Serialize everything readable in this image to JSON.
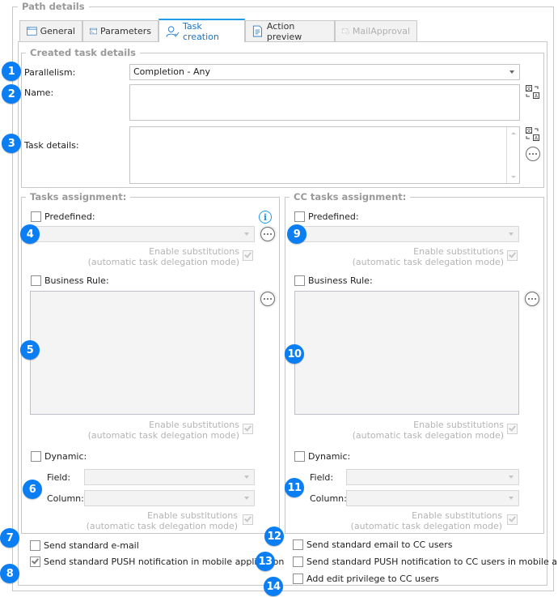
{
  "path_details": {
    "title": "Path details",
    "tabs": [
      {
        "label": "General",
        "icon": "window-icon",
        "state": "normal"
      },
      {
        "label": "Parameters",
        "icon": "console-window-icon",
        "state": "normal"
      },
      {
        "label": "Task creation",
        "icon": "user-task-icon",
        "state": "active"
      },
      {
        "label": "Action preview",
        "icon": "document-preview-icon",
        "state": "normal"
      },
      {
        "label": "MailApproval",
        "icon": "mail-approval-icon",
        "state": "disabled"
      }
    ]
  },
  "created_task_details": {
    "title": "Created task details",
    "parallelism_label": "Parallelism:",
    "parallelism_value": "Completion - Any",
    "name_label": "Name:",
    "name_value": "",
    "task_details_label": "Task details:",
    "task_details_value": "",
    "translate_icon": "translate-icon",
    "more_icon": "ellipsis-circle-icon"
  },
  "tasks_assignment": {
    "title": "Tasks assignment:",
    "predefined_label": "Predefined:",
    "predefined_checked": false,
    "predefined_value": "",
    "info_icon": "info-icon",
    "enable_substitutions_line1": "Enable substitutions",
    "enable_substitutions_line2": "(automatic task delegation mode)",
    "business_rule_label": "Business Rule:",
    "business_rule_checked": false,
    "dynamic_label": "Dynamic:",
    "dynamic_checked": false,
    "field_label": "Field:",
    "field_value": "",
    "column_label": "Column:",
    "column_value": ""
  },
  "cc_tasks_assignment": {
    "title": "CC tasks assignment:",
    "predefined_label": "Predefined:",
    "predefined_checked": false,
    "predefined_value": "",
    "enable_substitutions_line1": "Enable substitutions",
    "enable_substitutions_line2": "(automatic task delegation mode)",
    "business_rule_label": "Business Rule:",
    "business_rule_checked": false,
    "dynamic_label": "Dynamic:",
    "dynamic_checked": false,
    "field_label": "Field:",
    "field_value": "",
    "column_label": "Column:",
    "column_value": ""
  },
  "notifications": {
    "send_email_label": "Send standard e-mail",
    "send_email_checked": false,
    "send_push_label": "Send standard PUSH notification in mobile application",
    "send_push_checked": true,
    "send_cc_email_label": "Send standard email to CC users",
    "send_cc_email_checked": false,
    "send_cc_push_label": "Send standard PUSH notification to CC users in mobile app...",
    "send_cc_push_checked": false,
    "add_edit_privilege_label": "Add edit privilege to CC users",
    "add_edit_privilege_checked": false
  },
  "badges": [
    "1",
    "2",
    "3",
    "4",
    "5",
    "6",
    "7",
    "8",
    "9",
    "10",
    "11",
    "12",
    "13",
    "14"
  ],
  "colors": {
    "accent": "#1e9be6",
    "badge": "#0a7ef2",
    "legend_text": "#9a9a9a",
    "disabled_text": "#b4b4b4"
  }
}
